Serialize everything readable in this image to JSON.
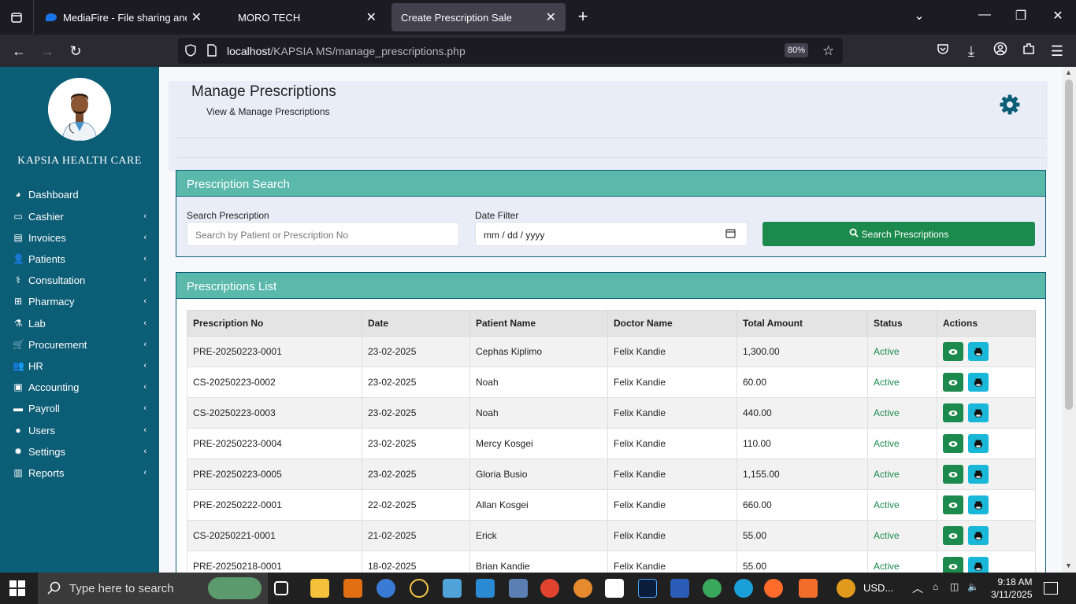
{
  "browser": {
    "tabs": [
      {
        "label": "MediaFire - File sharing and sto"
      },
      {
        "label": "MORO TECH"
      },
      {
        "label": "Create Prescription Sale"
      }
    ],
    "url_host": "localhost",
    "url_path": "/KAPSIA MS/manage_prescriptions.php",
    "zoom": "80%"
  },
  "sidebar": {
    "brand": "KAPSIA HEALTH CARE",
    "items": [
      {
        "label": "Dashboard",
        "icon": "dashboard-icon"
      },
      {
        "label": "Cashier",
        "icon": "desktop-icon"
      },
      {
        "label": "Invoices",
        "icon": "invoice-icon"
      },
      {
        "label": "Patients",
        "icon": "user-plus-icon"
      },
      {
        "label": "Consultation",
        "icon": "stethoscope-icon"
      },
      {
        "label": "Pharmacy",
        "icon": "medkit-icon"
      },
      {
        "label": "Lab",
        "icon": "flask-icon"
      },
      {
        "label": "Procurement",
        "icon": "cart-icon"
      },
      {
        "label": "HR",
        "icon": "users-icon"
      },
      {
        "label": "Accounting",
        "icon": "money-icon"
      },
      {
        "label": "Payroll",
        "icon": "credit-card-icon"
      },
      {
        "label": "Users",
        "icon": "user-icon"
      },
      {
        "label": "Settings",
        "icon": "cog-icon"
      },
      {
        "label": "Reports",
        "icon": "book-icon"
      }
    ]
  },
  "header": {
    "title": "Manage Prescriptions",
    "subtitle": "View & Manage Prescriptions"
  },
  "search": {
    "card_title": "Prescription Search",
    "search_label": "Search Prescription",
    "search_placeholder": "Search by Patient or Prescription No",
    "date_label": "Date Filter",
    "date_placeholder": "mm / dd / yyyy",
    "button_label": "Search Prescriptions"
  },
  "list": {
    "card_title": "Prescriptions List",
    "columns": [
      "Prescription No",
      "Date",
      "Patient Name",
      "Doctor Name",
      "Total Amount",
      "Status",
      "Actions"
    ],
    "rows": [
      {
        "no": "PRE-20250223-0001",
        "date": "23-02-2025",
        "patient": "Cephas Kiplimo",
        "doctor": "Felix Kandie",
        "amount": "1,300.00",
        "status": "Active"
      },
      {
        "no": "CS-20250223-0002",
        "date": "23-02-2025",
        "patient": "Noah",
        "doctor": "Felix Kandie",
        "amount": "60.00",
        "status": "Active"
      },
      {
        "no": "CS-20250223-0003",
        "date": "23-02-2025",
        "patient": "Noah",
        "doctor": "Felix Kandie",
        "amount": "440.00",
        "status": "Active"
      },
      {
        "no": "PRE-20250223-0004",
        "date": "23-02-2025",
        "patient": "Mercy Kosgei",
        "doctor": "Felix Kandie",
        "amount": "110.00",
        "status": "Active"
      },
      {
        "no": "PRE-20250223-0005",
        "date": "23-02-2025",
        "patient": "Gloria Busio",
        "doctor": "Felix Kandie",
        "amount": "1,155.00",
        "status": "Active"
      },
      {
        "no": "PRE-20250222-0001",
        "date": "22-02-2025",
        "patient": "Allan Kosgei",
        "doctor": "Felix Kandie",
        "amount": "660.00",
        "status": "Active"
      },
      {
        "no": "CS-20250221-0001",
        "date": "21-02-2025",
        "patient": "Erick",
        "doctor": "Felix Kandie",
        "amount": "55.00",
        "status": "Active"
      },
      {
        "no": "PRE-20250218-0001",
        "date": "18-02-2025",
        "patient": "Brian Kandie",
        "doctor": "Felix Kandie",
        "amount": "55.00",
        "status": "Active"
      }
    ]
  },
  "taskbar": {
    "search_placeholder": "Type here to search",
    "tray_text": "USD...",
    "time": "9:18 AM",
    "date": "3/11/2025"
  },
  "colors": {
    "sidebar": "#0c5d76",
    "card_header": "#5ab9ab",
    "success": "#1d8a4d",
    "print": "#19b7d8"
  }
}
